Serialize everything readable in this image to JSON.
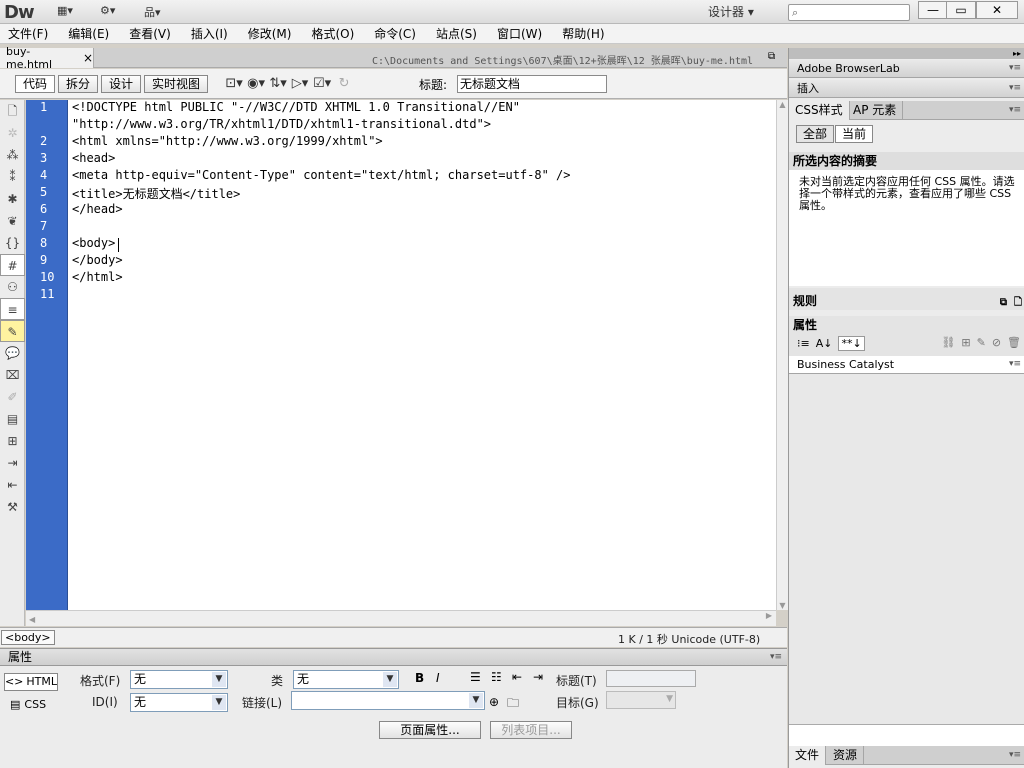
{
  "app": {
    "logo": "Dw",
    "workspace": "设计器 ▾"
  },
  "titlebar": {
    "icons": [
      "layout-icon",
      "gear-icon",
      "site-icon"
    ],
    "window_buttons": {
      "minimize": "—",
      "maximize": "▭",
      "close": "✕"
    }
  },
  "menu": [
    "文件(F)",
    "编辑(E)",
    "查看(V)",
    "插入(I)",
    "修改(M)",
    "格式(O)",
    "命令(C)",
    "站点(S)",
    "窗口(W)",
    "帮助(H)"
  ],
  "document": {
    "tab": "buy-me.html",
    "tab_close": "×",
    "path": "C:\\Documents and Settings\\607\\桌面\\12+张晨晖\\12 张晨晖\\buy-me.html"
  },
  "doc_toolbar": {
    "views": [
      "代码",
      "拆分",
      "设计",
      "实时视图"
    ],
    "title_label": "标题:",
    "title_value": "无标题文档"
  },
  "code": {
    "lines": [
      {
        "num": "1",
        "text": "<!DOCTYPE html PUBLIC \"-//W3C//DTD XHTML 1.0 Transitional//EN\""
      },
      {
        "num": "",
        "text": "\"http://www.w3.org/TR/xhtml1/DTD/xhtml1-transitional.dtd\">"
      },
      {
        "num": "2",
        "text": "<html xmlns=\"http://www.w3.org/1999/xhtml\">"
      },
      {
        "num": "3",
        "text": "<head>"
      },
      {
        "num": "4",
        "text": "<meta http-equiv=\"Content-Type\" content=\"text/html; charset=utf-8\" />"
      },
      {
        "num": "5",
        "text": "<title>无标题文档</title>"
      },
      {
        "num": "6",
        "text": "</head>"
      },
      {
        "num": "7",
        "text": ""
      },
      {
        "num": "8",
        "text": "<body>"
      },
      {
        "num": "9",
        "text": "</body>"
      },
      {
        "num": "10",
        "text": "</html>"
      },
      {
        "num": "11",
        "text": ""
      }
    ]
  },
  "status": {
    "tag": "<body>",
    "info": "1 K / 1 秒  Unicode (UTF-8)"
  },
  "properties": {
    "header": "属性",
    "html_btn": "HTML",
    "css_btn": "CSS",
    "format_label": "格式(F)",
    "format_value": "无",
    "id_label": "ID(I)",
    "id_value": "无",
    "class_label": "类",
    "class_value": "无",
    "link_label": "链接(L)",
    "link_value": "",
    "bold": "B",
    "italic": "I",
    "title_label": "标题(T)",
    "title_value": "",
    "target_label": "目标(G)",
    "target_value": "",
    "page_props_btn": "页面属性...",
    "list_items_btn": "列表项目..."
  },
  "right_panel": {
    "browserlab": "Adobe BrowserLab",
    "insert": "插入",
    "css_tab": "CSS样式",
    "ap_tab": "AP 元素",
    "all_btn": "全部",
    "current_btn": "当前",
    "summary_title": "所选内容的摘要",
    "summary_text": "未对当前选定内容应用任何 CSS 属性。请选择一个带样式的元素，查看应用了哪些 CSS 属性。",
    "rules_label": "规则",
    "props_label": "属性",
    "business_catalyst": "Business Catalyst",
    "files_tab": "文件",
    "assets_tab": "资源"
  }
}
